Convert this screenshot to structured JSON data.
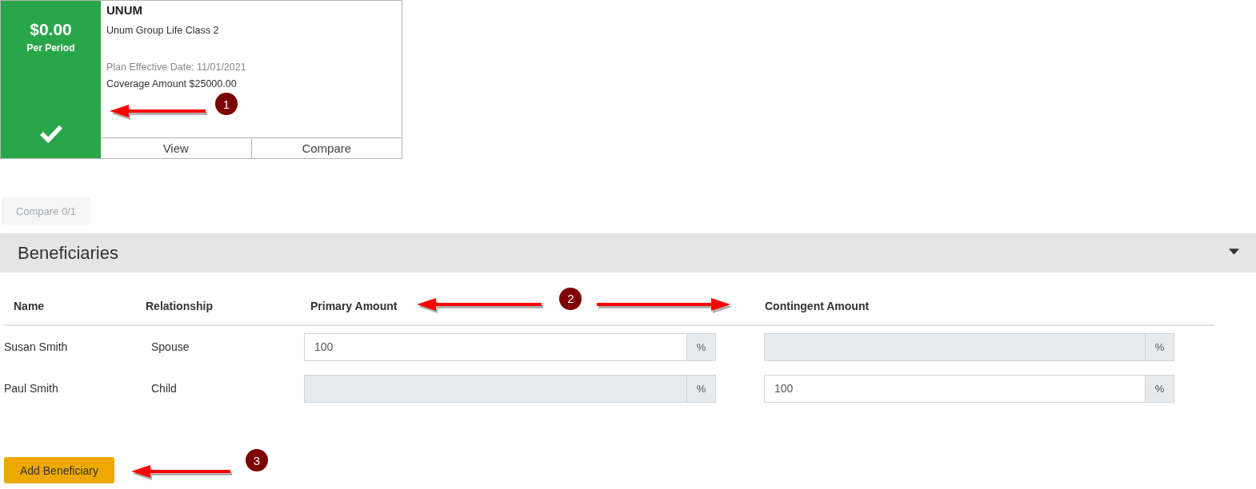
{
  "plan_card": {
    "price": "$0.00",
    "period": "Per Period",
    "selected": true,
    "carrier": "UNUM",
    "plan_name": "Unum Group Life Class 2",
    "effective_date": "Plan Effective Date: 11/01/2021",
    "coverage": "Coverage Amount $25000.00",
    "actions": [
      "View",
      "Compare"
    ],
    "annotation": "1"
  },
  "compare_button": {
    "label": "Compare 0/1",
    "disabled": true
  },
  "beneficiaries": {
    "title": "Beneficiaries",
    "expanded": true,
    "columns": [
      "Name",
      "Relationship",
      "Primary Amount",
      "Contingent Amount"
    ],
    "annotation": "2",
    "rows": [
      {
        "name": "Susan Smith",
        "relationship": "Spouse",
        "amounts": [
          {
            "value": "100",
            "disabled": false,
            "unit": "%"
          },
          {
            "disabled": true,
            "unit": "%"
          }
        ]
      },
      {
        "name": "Paul Smith",
        "relationship": "Child",
        "amounts": [
          {
            "disabled": true,
            "unit": "%"
          },
          {
            "value": "100",
            "disabled": false,
            "unit": "%"
          }
        ]
      }
    ]
  },
  "add_button": {
    "label": "Add Beneficiary",
    "annotation": "3"
  }
}
